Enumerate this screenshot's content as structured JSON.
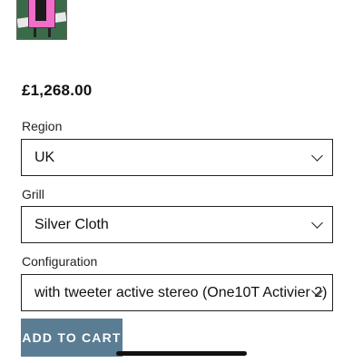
{
  "product": {
    "image_icon": "product-thumbnail",
    "price": "£1,268.00"
  },
  "options": [
    {
      "label": "Region",
      "selected": "UK"
    },
    {
      "label": "Grill",
      "selected": "Silver Cloth"
    },
    {
      "label": "Configuration",
      "selected": "with tweeter active stereo (One10T Activier 2)"
    }
  ],
  "actions": {
    "add_to_cart": "ADD TO CART"
  },
  "colors": {
    "button_bg": "#5a7d93",
    "button_text": "#ffffff"
  }
}
